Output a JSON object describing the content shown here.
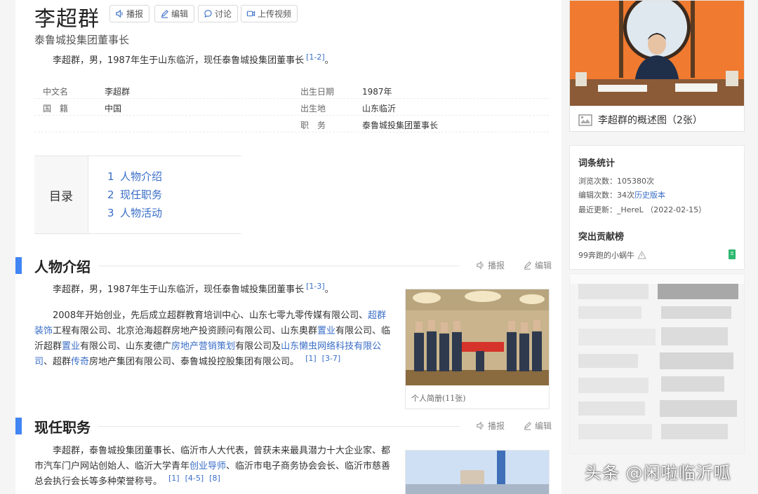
{
  "header": {
    "title": "李超群",
    "buttons": {
      "broadcast": "播报",
      "edit": "编辑",
      "discuss": "讨论",
      "upload_video": "上传视频"
    },
    "subtitle": "泰鲁城投集团董事长"
  },
  "summary": {
    "text": "李超群，男，1987年生于山东临沂，现任泰鲁城投集团董事长",
    "ref": "[1-2]",
    "end": "。"
  },
  "basic_info": {
    "rows": [
      {
        "l1": "中文名",
        "v1": "李超群",
        "l2": "出生日期",
        "v2": "1987年"
      },
      {
        "l1": "国　籍",
        "v1": "中国",
        "l2": "出生地",
        "v2": "山东临沂"
      },
      {
        "l1": "",
        "v1": "",
        "l2": "职　务",
        "v2": "泰鲁城投集团董事长"
      }
    ]
  },
  "toc": {
    "heading": "目录",
    "items": [
      {
        "num": "1",
        "label": "人物介绍"
      },
      {
        "num": "2",
        "label": "现任职务"
      },
      {
        "num": "3",
        "label": "人物活动"
      }
    ]
  },
  "section1": {
    "title": "人物介绍",
    "broadcast": "播报",
    "edit": "编辑",
    "p1": {
      "text": "李超群，男，1987年生于山东临沂，现任泰鲁城投集团董事长",
      "ref": "[1-3]",
      "end": "。"
    },
    "p2": {
      "line1a": "2008年开始创业，先后成立超群教育培训中心、山东七零九零传媒有限公司、",
      "line1b": "超群",
      "line2a": "装饰",
      "line2b": "工程有限公司、北京沧海超群房地产投资顾问有限公司、山东奥群",
      "line2c": "置业",
      "line2d": "有限公司、临",
      "line3a": "沂超群",
      "line3b": "置业",
      "line3c": "有限公司、山东麦德广",
      "line3d": "房地产营销策划",
      "line3e": "有限公司及",
      "line3f": "山东懒虫网络科技有限公",
      "line4a": "司",
      "line4b": "、超群",
      "line4c": "传奇",
      "line4d": "房地产集团有限公司、泰鲁城投控股集团有限公司。",
      "ref1": "[1]",
      "ref2": "[3-7]"
    },
    "image_caption": "个人简册(11张)"
  },
  "section2": {
    "title": "现任职务",
    "broadcast": "播报",
    "edit": "编辑",
    "line1": "李超群，泰鲁城投集团董事长、临沂市人大代表，曾获未来最具潜力十大企业家、都",
    "line2a": "市汽车门户网站创始人、临沂大学青年",
    "line2b": "创业导师",
    "line2c": "、临沂市电子商务协会会长、临沂市慈善",
    "line3": "总会执行会长等多种荣誉称号。",
    "ref1": "[1]",
    "ref2": "[4-5]",
    "ref3": "[8]"
  },
  "sidebar": {
    "photo_caption": "李超群的概述图（2张）",
    "stats": {
      "title": "词条统计",
      "views": "浏览次数：105380次",
      "edits_prefix": "编辑次数：34次",
      "history_link": "历史版本",
      "last_update": "最近更新：_HereL （2022-02-15）",
      "contrib_title": "突出贡献榜",
      "contributor": "99奔跑的小蜗牛"
    }
  },
  "watermark": "头条 @闲啦临沂呱",
  "colors": {
    "accent": "#4285f4",
    "link": "#3a6ec7",
    "photo_bg": "#f07a2f"
  }
}
